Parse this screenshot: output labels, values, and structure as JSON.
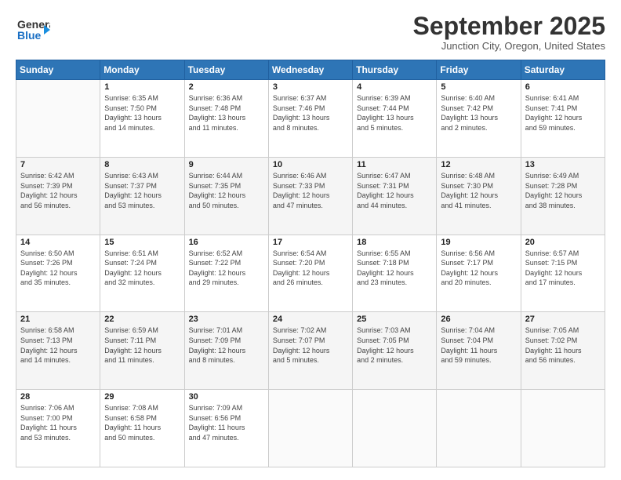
{
  "header": {
    "logo_line1": "General",
    "logo_line2": "Blue",
    "month": "September 2025",
    "location": "Junction City, Oregon, United States"
  },
  "days_of_week": [
    "Sunday",
    "Monday",
    "Tuesday",
    "Wednesday",
    "Thursday",
    "Friday",
    "Saturday"
  ],
  "weeks": [
    [
      {
        "day": "",
        "info": ""
      },
      {
        "day": "1",
        "info": "Sunrise: 6:35 AM\nSunset: 7:50 PM\nDaylight: 13 hours\nand 14 minutes."
      },
      {
        "day": "2",
        "info": "Sunrise: 6:36 AM\nSunset: 7:48 PM\nDaylight: 13 hours\nand 11 minutes."
      },
      {
        "day": "3",
        "info": "Sunrise: 6:37 AM\nSunset: 7:46 PM\nDaylight: 13 hours\nand 8 minutes."
      },
      {
        "day": "4",
        "info": "Sunrise: 6:39 AM\nSunset: 7:44 PM\nDaylight: 13 hours\nand 5 minutes."
      },
      {
        "day": "5",
        "info": "Sunrise: 6:40 AM\nSunset: 7:42 PM\nDaylight: 13 hours\nand 2 minutes."
      },
      {
        "day": "6",
        "info": "Sunrise: 6:41 AM\nSunset: 7:41 PM\nDaylight: 12 hours\nand 59 minutes."
      }
    ],
    [
      {
        "day": "7",
        "info": "Sunrise: 6:42 AM\nSunset: 7:39 PM\nDaylight: 12 hours\nand 56 minutes."
      },
      {
        "day": "8",
        "info": "Sunrise: 6:43 AM\nSunset: 7:37 PM\nDaylight: 12 hours\nand 53 minutes."
      },
      {
        "day": "9",
        "info": "Sunrise: 6:44 AM\nSunset: 7:35 PM\nDaylight: 12 hours\nand 50 minutes."
      },
      {
        "day": "10",
        "info": "Sunrise: 6:46 AM\nSunset: 7:33 PM\nDaylight: 12 hours\nand 47 minutes."
      },
      {
        "day": "11",
        "info": "Sunrise: 6:47 AM\nSunset: 7:31 PM\nDaylight: 12 hours\nand 44 minutes."
      },
      {
        "day": "12",
        "info": "Sunrise: 6:48 AM\nSunset: 7:30 PM\nDaylight: 12 hours\nand 41 minutes."
      },
      {
        "day": "13",
        "info": "Sunrise: 6:49 AM\nSunset: 7:28 PM\nDaylight: 12 hours\nand 38 minutes."
      }
    ],
    [
      {
        "day": "14",
        "info": "Sunrise: 6:50 AM\nSunset: 7:26 PM\nDaylight: 12 hours\nand 35 minutes."
      },
      {
        "day": "15",
        "info": "Sunrise: 6:51 AM\nSunset: 7:24 PM\nDaylight: 12 hours\nand 32 minutes."
      },
      {
        "day": "16",
        "info": "Sunrise: 6:52 AM\nSunset: 7:22 PM\nDaylight: 12 hours\nand 29 minutes."
      },
      {
        "day": "17",
        "info": "Sunrise: 6:54 AM\nSunset: 7:20 PM\nDaylight: 12 hours\nand 26 minutes."
      },
      {
        "day": "18",
        "info": "Sunrise: 6:55 AM\nSunset: 7:18 PM\nDaylight: 12 hours\nand 23 minutes."
      },
      {
        "day": "19",
        "info": "Sunrise: 6:56 AM\nSunset: 7:17 PM\nDaylight: 12 hours\nand 20 minutes."
      },
      {
        "day": "20",
        "info": "Sunrise: 6:57 AM\nSunset: 7:15 PM\nDaylight: 12 hours\nand 17 minutes."
      }
    ],
    [
      {
        "day": "21",
        "info": "Sunrise: 6:58 AM\nSunset: 7:13 PM\nDaylight: 12 hours\nand 14 minutes."
      },
      {
        "day": "22",
        "info": "Sunrise: 6:59 AM\nSunset: 7:11 PM\nDaylight: 12 hours\nand 11 minutes."
      },
      {
        "day": "23",
        "info": "Sunrise: 7:01 AM\nSunset: 7:09 PM\nDaylight: 12 hours\nand 8 minutes."
      },
      {
        "day": "24",
        "info": "Sunrise: 7:02 AM\nSunset: 7:07 PM\nDaylight: 12 hours\nand 5 minutes."
      },
      {
        "day": "25",
        "info": "Sunrise: 7:03 AM\nSunset: 7:05 PM\nDaylight: 12 hours\nand 2 minutes."
      },
      {
        "day": "26",
        "info": "Sunrise: 7:04 AM\nSunset: 7:04 PM\nDaylight: 11 hours\nand 59 minutes."
      },
      {
        "day": "27",
        "info": "Sunrise: 7:05 AM\nSunset: 7:02 PM\nDaylight: 11 hours\nand 56 minutes."
      }
    ],
    [
      {
        "day": "28",
        "info": "Sunrise: 7:06 AM\nSunset: 7:00 PM\nDaylight: 11 hours\nand 53 minutes."
      },
      {
        "day": "29",
        "info": "Sunrise: 7:08 AM\nSunset: 6:58 PM\nDaylight: 11 hours\nand 50 minutes."
      },
      {
        "day": "30",
        "info": "Sunrise: 7:09 AM\nSunset: 6:56 PM\nDaylight: 11 hours\nand 47 minutes."
      },
      {
        "day": "",
        "info": ""
      },
      {
        "day": "",
        "info": ""
      },
      {
        "day": "",
        "info": ""
      },
      {
        "day": "",
        "info": ""
      }
    ]
  ]
}
